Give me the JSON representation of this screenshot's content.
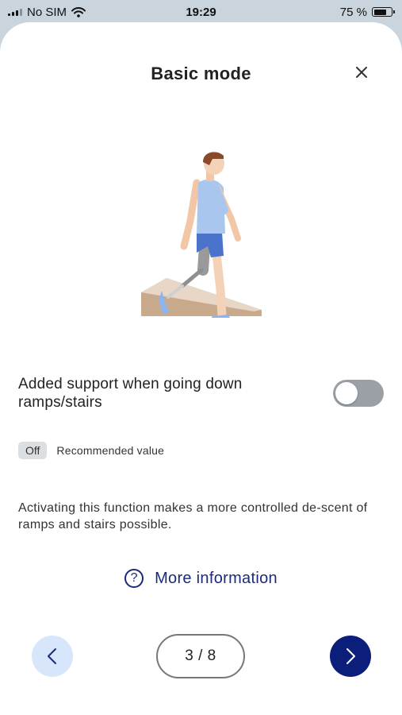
{
  "status_bar": {
    "carrier": "No SIM",
    "time": "19:29",
    "battery": "75 %",
    "battery_level": 0.75,
    "wifi_icon": "wifi-icon",
    "signal_icon": "signal-icon"
  },
  "header": {
    "title": "Basic mode",
    "close_icon": "close-icon"
  },
  "illustration": {
    "icon": "prosthetic-leg-walking-down-ramp-illustration"
  },
  "setting": {
    "label": "Added support when going down ramps/stairs",
    "toggle_on": false,
    "recommended_badge": "Off",
    "recommended_label": "Recommended value",
    "description": "Activating this function makes a more controlled de-scent of ramps and stairs possible."
  },
  "more_info": {
    "icon": "?",
    "label": "More information"
  },
  "pagination": {
    "current_label": "3 / 8",
    "prev_icon": "chevron-left-icon",
    "next_icon": "chevron-right-icon"
  },
  "colors": {
    "accent": "#0b1f7a",
    "link": "#1a2b7a",
    "prev_bg": "#d8e6fb",
    "toggle_off": "#9aa0a6"
  }
}
